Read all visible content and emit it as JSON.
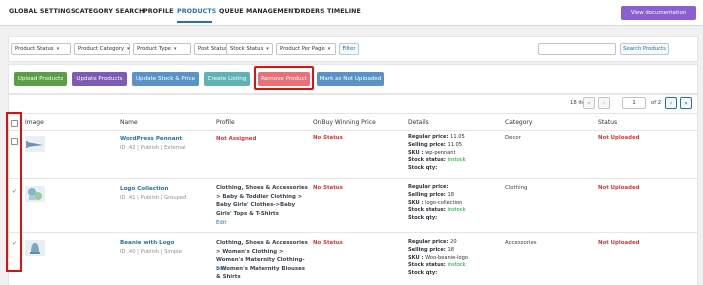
{
  "nav": {
    "items": [
      {
        "label": "GLOBAL SETTINGS"
      },
      {
        "label": "CATEGORY SEARCH"
      },
      {
        "label": "PROFILE"
      },
      {
        "label": "PRODUCTS"
      },
      {
        "label": "QUEUE MANAGEMENT"
      },
      {
        "label": "ORDERS"
      },
      {
        "label": "TIMELINE"
      }
    ],
    "separator": "|",
    "active": "PRODUCTS",
    "doc_button": "View documentation"
  },
  "filters": {
    "dropdowns": [
      {
        "label": "Product Status"
      },
      {
        "label": "Product Category"
      },
      {
        "label": "Product Type"
      },
      {
        "label": "Post Status"
      },
      {
        "label": "Stock Status"
      },
      {
        "label": "Product Per Page"
      }
    ],
    "filter_button": "Filter",
    "search_placeholder": "",
    "search_button": "Search Products"
  },
  "actions": [
    {
      "label": "Upload Products",
      "color": "#5b9e47"
    },
    {
      "label": "Update Products",
      "color": "#7b5bb4"
    },
    {
      "label": "Update Stock & Price",
      "color": "#5b93c7"
    },
    {
      "label": "Create Listing",
      "color": "#5fb3b3"
    },
    {
      "label": "Remove Product",
      "color": "#e8707a"
    },
    {
      "label": "Mark as Not Uploaded",
      "color": "#5b93c7"
    }
  ],
  "pagination": {
    "items_text": "18 items",
    "first": "«",
    "prev": "‹",
    "current": "1",
    "of_text": "of 2",
    "next": "›",
    "last": "»"
  },
  "table": {
    "headers": [
      "Image",
      "Name",
      "Profile",
      "OnBuy Winning Price",
      "Details",
      "Category",
      "Status"
    ],
    "rows": [
      {
        "checked": false,
        "name": "WordPress Pennant",
        "meta": "ID :42 | Publish | External",
        "profile": "Not Assigned",
        "profile_edit": "",
        "onbuy": "No Status",
        "regular_label": "Regular price:",
        "regular": " 11.05",
        "selling_label": "Selling price:",
        "selling": " 11.05",
        "sku_label": "SKU :",
        "sku": " wp-pennant",
        "stock_label": "Stock status:",
        "stock": " instock",
        "qty_label": "Stock qty:",
        "category": "Decor",
        "status": "Not Uploaded"
      },
      {
        "checked": true,
        "name": "Logo Collection",
        "meta": "ID :41 | Publish | Grouped",
        "profile": "Clothing, Shoes & Accessories > Baby & Toddler Clothing > Baby Girls' Clothes->Baby Girls' Tops & T-Shirts",
        "profile_edit": "Edit",
        "onbuy": "No Status",
        "regular_label": "Regular price:",
        "regular": "",
        "selling_label": "Selling price:",
        "selling": " 18",
        "sku_label": "SKU :",
        "sku": " logo-collection",
        "stock_label": "Stock status:",
        "stock": " instock",
        "qty_label": "Stock qty:",
        "category": "Clothing",
        "status": "Not Uploaded"
      },
      {
        "checked": true,
        "name": "Beanie with Logo",
        "meta": "ID :40 | Publish | Simple",
        "profile": "Clothing, Shoes & Accessories > Women's Clothing > Women's Maternity Clothing->Women's Maternity Blouses & Shirts",
        "profile_edit": "Edit",
        "onbuy": "No Status",
        "regular_label": "Regular price:",
        "regular": " 20",
        "selling_label": "Selling price:",
        "selling": " 18",
        "sku_label": "SKU :",
        "sku": " Woo-beanie-logo",
        "stock_label": "Stock status:",
        "stock": " instock",
        "qty_label": "Stock qty:",
        "category": "Accessories",
        "status": "Not Uploaded"
      }
    ]
  },
  "check_glyph": "✓"
}
